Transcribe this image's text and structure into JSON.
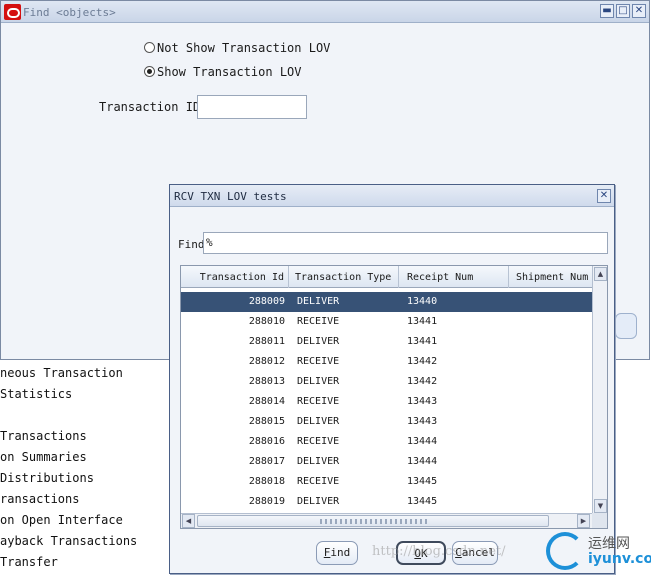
{
  "find_window": {
    "title": "Find <objects>",
    "radio_not_show": "Not Show Transaction LOV",
    "radio_show": "Show Transaction LOV",
    "radio_show_selected": true,
    "transaction_id_label": "Transaction ID",
    "transaction_id_value": "",
    "window_buttons": {
      "minimize": "▬",
      "maximize": "□",
      "close": "✕"
    }
  },
  "background_menu": [
    "neous Transaction",
    " Statistics",
    " Transactions",
    "on Summaries",
    " Distributions",
    "ransactions",
    "on Open Interface",
    "ayback Transactions",
    " Transfer"
  ],
  "lov": {
    "title": "RCV TXN LOV tests",
    "close": "✕",
    "find_label": "Find",
    "find_value": "%",
    "columns": [
      "Transaction Id",
      "Transaction Type",
      "Receipt Num",
      "Shipment Num"
    ],
    "rows": [
      {
        "id": "288009",
        "type": "DELIVER",
        "receipt": "13440"
      },
      {
        "id": "288010",
        "type": "RECEIVE",
        "receipt": "13441"
      },
      {
        "id": "288011",
        "type": "DELIVER",
        "receipt": "13441"
      },
      {
        "id": "288012",
        "type": "RECEIVE",
        "receipt": "13442"
      },
      {
        "id": "288013",
        "type": "DELIVER",
        "receipt": "13442"
      },
      {
        "id": "288014",
        "type": "RECEIVE",
        "receipt": "13443"
      },
      {
        "id": "288015",
        "type": "DELIVER",
        "receipt": "13443"
      },
      {
        "id": "288016",
        "type": "RECEIVE",
        "receipt": "13444"
      },
      {
        "id": "288017",
        "type": "DELIVER",
        "receipt": "13444"
      },
      {
        "id": "288018",
        "type": "RECEIVE",
        "receipt": "13445"
      },
      {
        "id": "288019",
        "type": "DELIVER",
        "receipt": "13445"
      }
    ],
    "selected_row": 0,
    "buttons": {
      "find": {
        "mnemonic": "F",
        "rest": "ind"
      },
      "ok": {
        "mnemonic": "O",
        "rest": "K"
      },
      "cancel": {
        "mnemonic": "C",
        "rest": "ancel"
      }
    }
  },
  "watermark": {
    "text": "http://blog.csdn.net/",
    "logo_line1": "运维网",
    "logo_line2": "iyunv.com"
  },
  "colors": {
    "selection": "#375276",
    "oracle_red": "#d41010",
    "dialog_bg": "#f1f4f9"
  }
}
